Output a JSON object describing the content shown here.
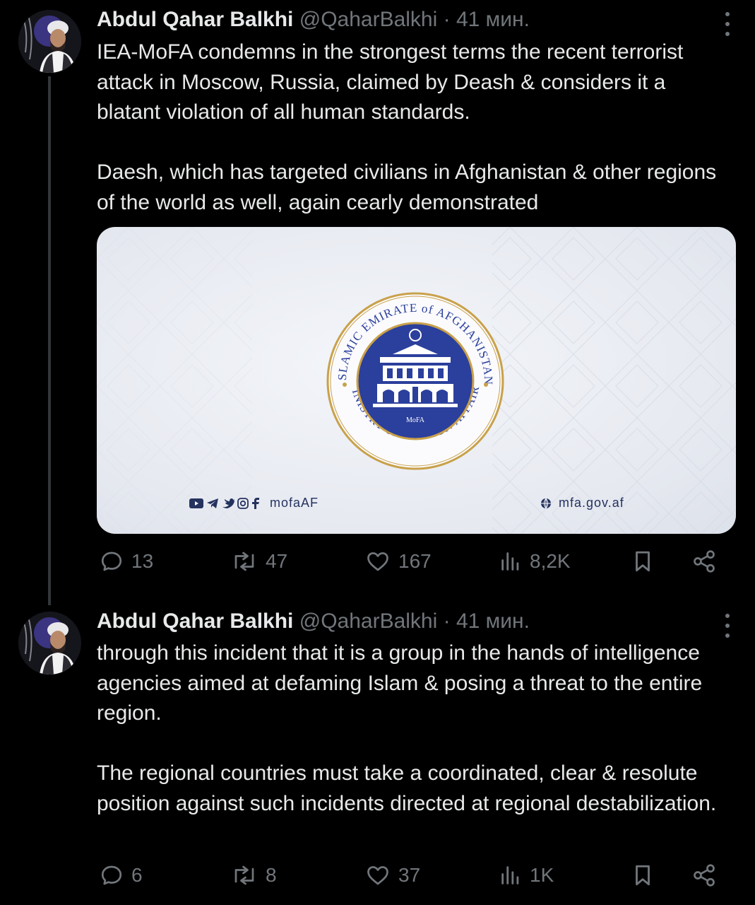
{
  "colors": {
    "background": "#000000",
    "text": "#e7e9ea",
    "muted": "#71767b",
    "thread_line": "#333639",
    "seal_blue": "#2b3f9c",
    "seal_gold": "#c9a14a"
  },
  "tweets": [
    {
      "author": {
        "name": "Abdul Qahar Balkhi",
        "handle": "@QaharBalkhi",
        "separator": "·",
        "time": "41 мин."
      },
      "text_p1": "IEA-MoFA condemns in the strongest terms the recent terrorist attack in Moscow, Russia, claimed by Deash & considers it a blatant violation of all human standards.",
      "text_p2": "Daesh, which has targeted civilians in Afghanistan & other regions of the world as well, again cearly demonstrated",
      "media": {
        "seal_top_text": "ISLAMIC EMIRATE of AFGHANISTAN",
        "seal_bottom_text": "MINISTRY of FOREIGN AFFAIRS",
        "seal_center_label": "MoFA",
        "social_icons": [
          "youtube-icon",
          "telegram-icon",
          "twitter-icon",
          "instagram-icon",
          "facebook-icon"
        ],
        "social_handle": "mofaAF",
        "website": "mfa.gov.af"
      },
      "stats": {
        "replies": "13",
        "reposts": "47",
        "likes": "167",
        "views": "8,2K"
      }
    },
    {
      "author": {
        "name": "Abdul Qahar Balkhi",
        "handle": "@QaharBalkhi",
        "separator": "·",
        "time": "41 мин."
      },
      "text_p1": "through this incident that it is a group in the hands of intelligence agencies aimed at defaming Islam & posing a threat to the entire region.",
      "text_p2": "The regional countries must take a coordinated, clear & resolute position against such incidents directed at regional destabilization.",
      "stats": {
        "replies": "6",
        "reposts": "8",
        "likes": "37",
        "views": "1K"
      }
    }
  ]
}
